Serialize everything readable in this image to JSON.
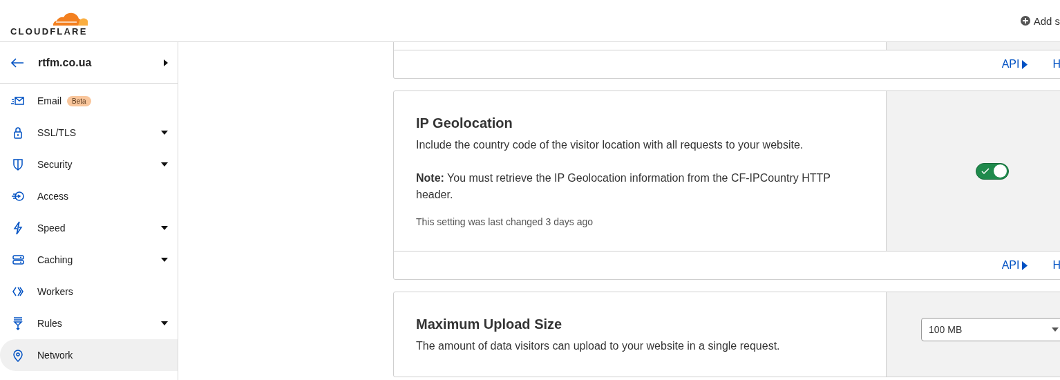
{
  "header": {
    "logo_text": "CLOUDFLARE",
    "add_button": "Add s"
  },
  "sidebar": {
    "site": "rtfm.co.ua",
    "items": [
      {
        "label": "Email",
        "badge": "Beta",
        "expandable": false,
        "selected": false
      },
      {
        "label": "SSL/TLS",
        "expandable": true,
        "selected": false
      },
      {
        "label": "Security",
        "expandable": true,
        "selected": false
      },
      {
        "label": "Access",
        "expandable": false,
        "selected": false
      },
      {
        "label": "Speed",
        "expandable": true,
        "selected": false
      },
      {
        "label": "Caching",
        "expandable": true,
        "selected": false
      },
      {
        "label": "Workers",
        "expandable": false,
        "selected": false
      },
      {
        "label": "Rules",
        "expandable": true,
        "selected": false
      },
      {
        "label": "Network",
        "expandable": false,
        "selected": true
      }
    ]
  },
  "cards": [
    {
      "kind": "partial",
      "links": [
        "API",
        "H"
      ]
    },
    {
      "kind": "toggle",
      "title": "IP Geolocation",
      "description": "Include the country code of the visitor location with all requests to your website.",
      "note": "**Note:** You must retrieve the IP Geolocation information from the CF-IPCountry HTTP header.",
      "changed": "This setting was last changed 3 days ago",
      "toggle": {
        "on": true
      },
      "links": [
        "API",
        "H"
      ]
    },
    {
      "kind": "select",
      "title": "Maximum Upload Size",
      "description": "The amount of data visitors can upload to your website in a single request.",
      "select": {
        "value": "100 MB"
      }
    }
  ]
}
